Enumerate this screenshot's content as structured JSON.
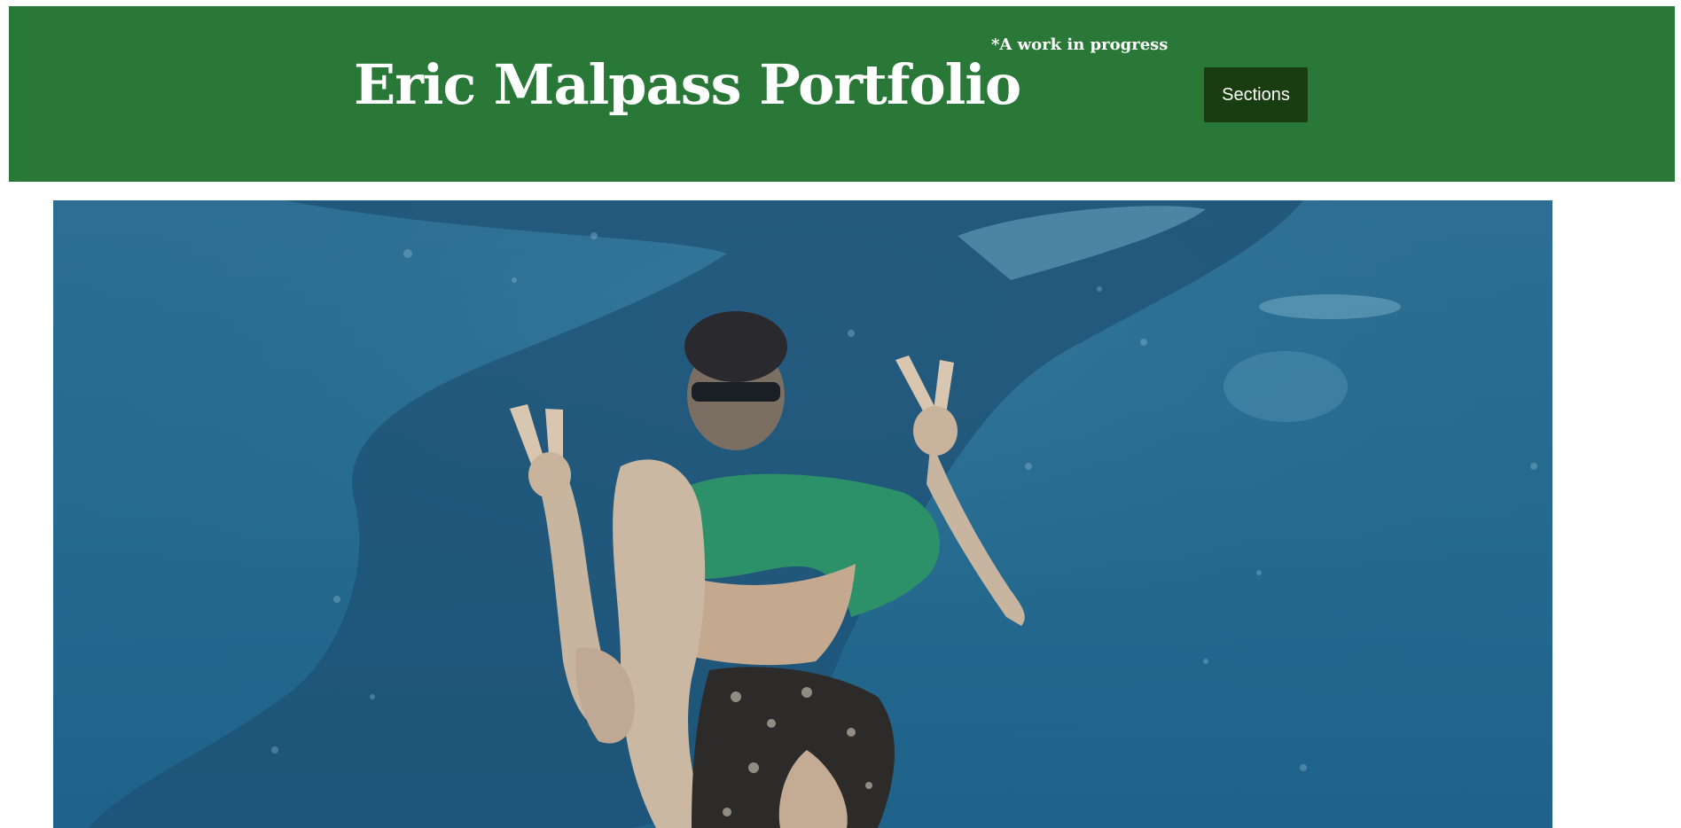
{
  "header": {
    "title": "Eric Malpass Portfolio",
    "subtitle": "*A work in progress",
    "sections_label": "Sections"
  },
  "hero": {
    "alt": "Eric swimming underwater next to a whale shark, making peace signs"
  },
  "colors": {
    "header_bg": "#2a7838",
    "button_bg": "#1a3c11",
    "water": "#2b6e93"
  }
}
